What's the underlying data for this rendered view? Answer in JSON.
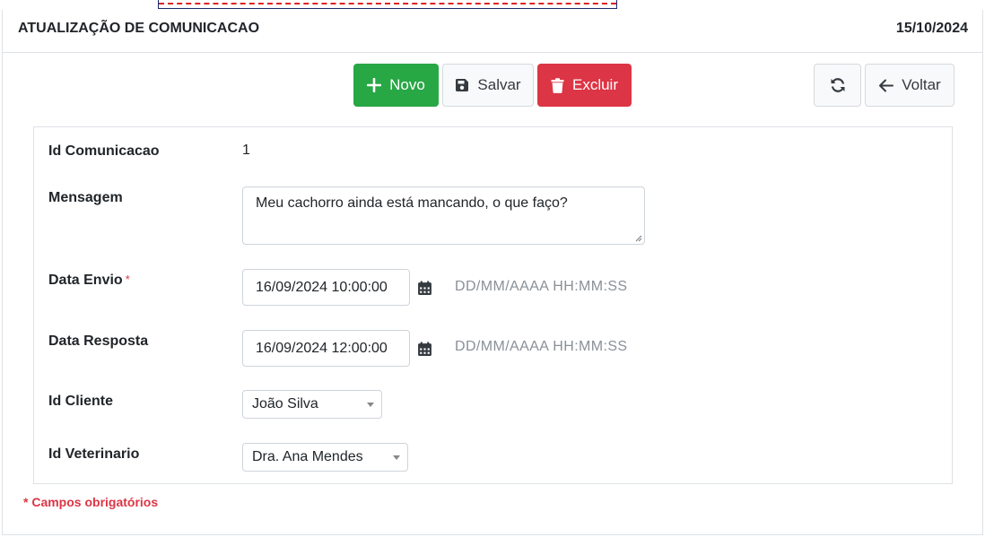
{
  "header": {
    "title": "ATUALIZAÇÃO DE COMUNICACAO",
    "date": "15/10/2024"
  },
  "toolbar": {
    "new_label": "Novo",
    "save_label": "Salvar",
    "delete_label": "Excluir",
    "back_label": "Voltar",
    "icons": {
      "new": "plus-icon",
      "save": "floppy-disk-icon",
      "delete": "trash-icon",
      "refresh": "refresh-icon",
      "back": "arrow-left-icon"
    },
    "colors": {
      "new": "#28a745",
      "delete": "#dc3545",
      "neutral": "#f8f9fa"
    }
  },
  "form": {
    "id_label": "Id Comunicacao",
    "id_value": "1",
    "message_label": "Mensagem",
    "message_value": "Meu cachorro ainda está mancando, o que faço?",
    "send_label": "Data Envio",
    "required_mark": "*",
    "send_value": "16/09/2024 10:00:00",
    "send_hint": "DD/MM/AAAA HH:MM:SS",
    "response_label": "Data Resposta",
    "response_value": "16/09/2024 12:00:00",
    "response_hint": "DD/MM/AAAA HH:MM:SS",
    "client_label": "Id Cliente",
    "client_value": "João Silva",
    "vet_label": "Id Veterinario",
    "vet_value": "Dra. Ana Mendes"
  },
  "footnote": "* Campos obrigatórios"
}
